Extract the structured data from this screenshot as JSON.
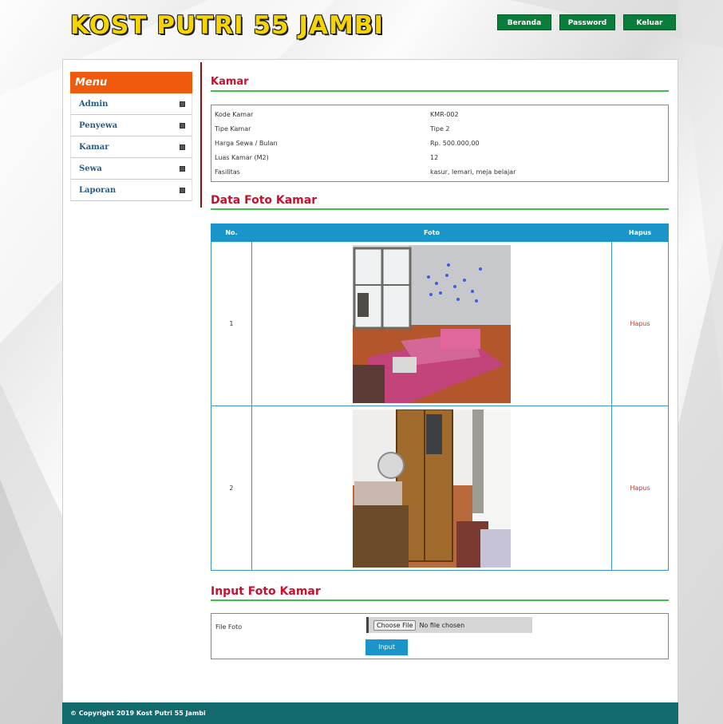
{
  "site": {
    "title": "KOST PUTRI 55 JAMBI"
  },
  "nav": {
    "beranda": "Beranda",
    "password": "Password",
    "keluar": "Keluar"
  },
  "sidebar": {
    "heading": "Menu",
    "items": [
      {
        "label": "Admin"
      },
      {
        "label": "Penyewa"
      },
      {
        "label": "Kamar"
      },
      {
        "label": "Sewa"
      },
      {
        "label": "Laporan"
      }
    ]
  },
  "kamar": {
    "title": "Kamar",
    "rows": [
      {
        "key": "Kode Kamar",
        "value": "KMR-002"
      },
      {
        "key": "Tipe Kamar",
        "value": "Tipe 2"
      },
      {
        "key": "Harga Sewa / Bulan",
        "value": "Rp. 500.000,00"
      },
      {
        "key": "Luas Kamar (M2)",
        "value": "12"
      },
      {
        "key": "Fasilitas",
        "value": "kasur, lemari, meja belajar"
      }
    ]
  },
  "foto": {
    "title": "Data Foto Kamar",
    "headers": {
      "no": "No.",
      "foto": "Foto",
      "hapus": "Hapus"
    },
    "rows": [
      {
        "no": "1",
        "action": "Hapus"
      },
      {
        "no": "2",
        "action": "Hapus"
      }
    ]
  },
  "input_foto": {
    "title": "Input Foto Kamar",
    "label": "File Foto",
    "choose_button": "Choose File",
    "file_status": "No file chosen",
    "submit": "Input"
  },
  "footer": {
    "text": "© Copyright 2019 Kost Putri 55 Jambi"
  }
}
